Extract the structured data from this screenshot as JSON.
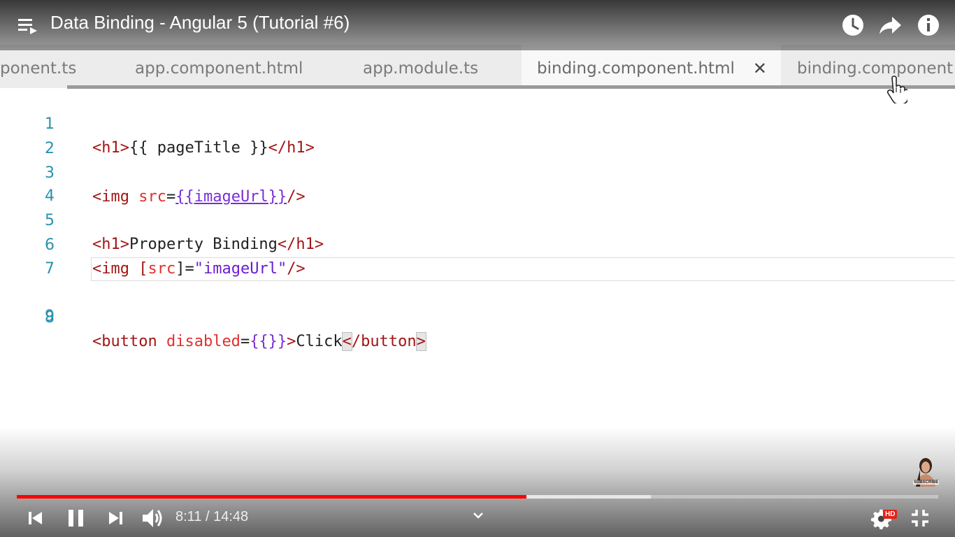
{
  "video": {
    "title": "Data Binding - Angular 5 (Tutorial #6)"
  },
  "editor": {
    "tabs": [
      {
        "label": "ponent.ts",
        "active": false
      },
      {
        "label": "app.component.html",
        "active": false
      },
      {
        "label": "app.module.ts",
        "active": false
      },
      {
        "label": "binding.component.html",
        "active": true,
        "close": "✕"
      },
      {
        "label": "binding.component",
        "active": false
      }
    ],
    "lines": [
      {
        "num": "1"
      },
      {
        "num": "2"
      },
      {
        "num": "3"
      },
      {
        "num": "4"
      },
      {
        "num": "5"
      },
      {
        "num": "6"
      },
      {
        "num": "7"
      },
      {
        "num": "8"
      },
      {
        "num": "9"
      }
    ],
    "code": {
      "l1": {
        "open": "<h1>",
        "text": "{{ pageTitle }}",
        "close": "</h1>"
      },
      "l3": {
        "open": "<img ",
        "attr": "src",
        "eq": "=",
        "expr": "{{imageUrl}}",
        "close": "/>"
      },
      "l5": {
        "open": "<h1>",
        "text": "Property Binding",
        "close": "</h1>"
      },
      "l6": {
        "open": "<img [",
        "attr": "src",
        "mid": "]=",
        "str": "\"imageUrl\"",
        "close": "/>"
      },
      "l8": {
        "open": "<button ",
        "attr": "disabled",
        "eq": "=",
        "expr": "{{}}",
        "gt": ">",
        "text": "Click",
        "lt": "<",
        "endtag": "/button",
        "endgt": ">"
      }
    }
  },
  "player": {
    "time_current": "8:11",
    "time_separator": " / ",
    "time_total": "14:48",
    "progress_played_pct": 55.3,
    "progress_buffered_pct": 68.8,
    "hd_label": "HD",
    "subscribe_label": "SUBSCRIBE",
    "colors": {
      "played": "#ff0000",
      "hd": "#e62117"
    },
    "icons": [
      "playlist-icon",
      "clock-icon",
      "share-icon",
      "info-icon",
      "previous-icon",
      "pause-icon",
      "next-icon",
      "volume-icon",
      "chevron-down-icon",
      "settings-icon",
      "exit-fullscreen-icon"
    ]
  }
}
